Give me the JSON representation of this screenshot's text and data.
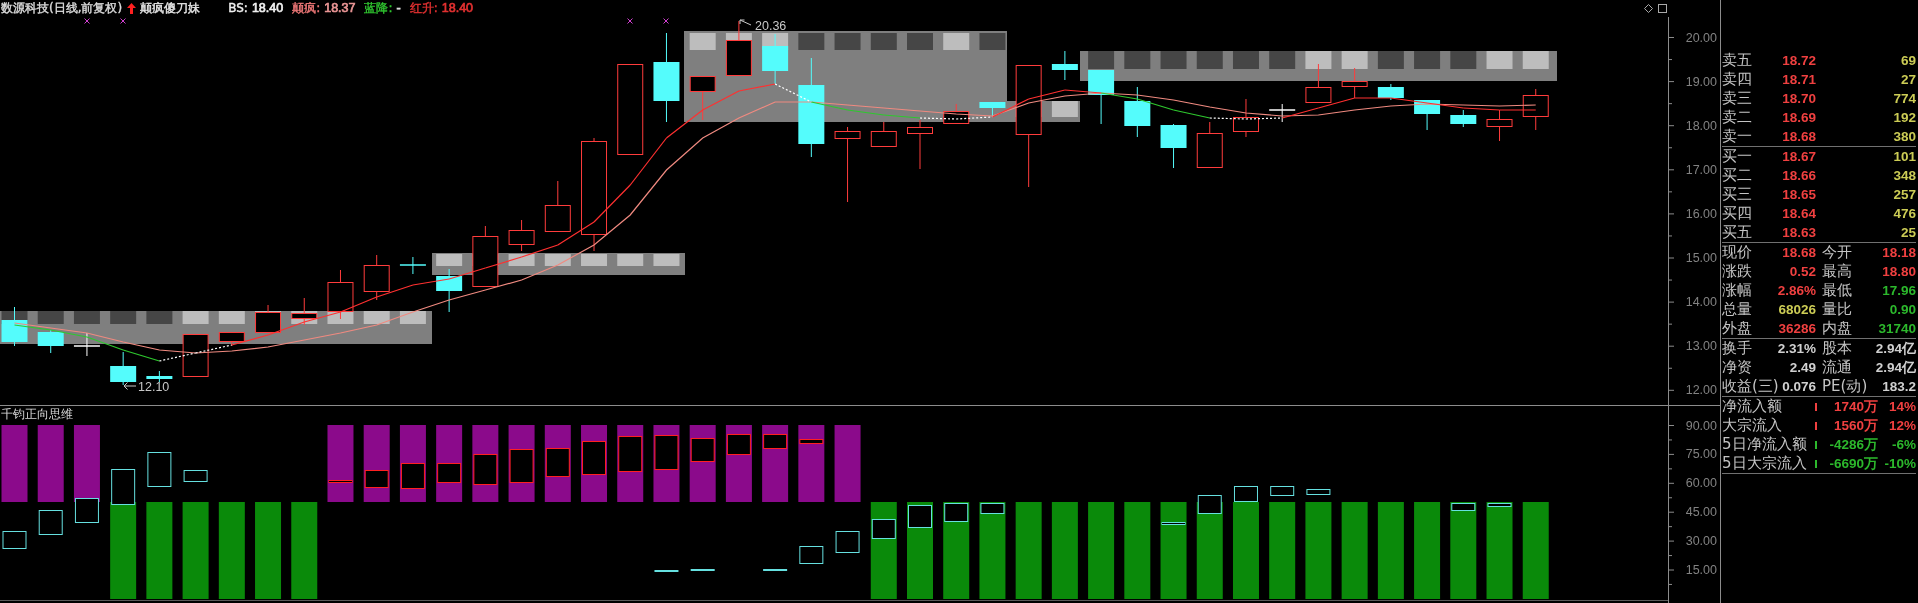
{
  "header": {
    "security": "数源科技(日线,前复权)",
    "formula": "颠疯傻刀妹",
    "readouts": [
      {
        "label": "BS:",
        "color": "#f0f0f0",
        "value": {
          "text": "18.40",
          "color": "#f0f0f0"
        }
      },
      {
        "label": "颠疯:",
        "color": "#f07878",
        "value": {
          "text": "18.37",
          "color": "#e89494"
        }
      },
      {
        "label": "蓝降:",
        "color": "#30c830",
        "value": {
          "text": "-",
          "color": "#e0e0e0"
        }
      },
      {
        "label": "红升:",
        "color": "#e03030",
        "value": {
          "text": "18.40",
          "color": "#e03030"
        }
      }
    ]
  },
  "main_chart": {
    "high_label": "20.36",
    "low_label": "12.10",
    "axis_labels": [
      "20.00",
      "19.00",
      "18.00",
      "17.00",
      "16.00",
      "15.00",
      "14.00",
      "13.00",
      "12.00"
    ]
  },
  "indicator": {
    "title": "千钧正向思维",
    "axis_labels": [
      "90.00",
      "75.00",
      "60.00",
      "45.00",
      "30.00",
      "15.00"
    ]
  },
  "order_book": {
    "asks": [
      {
        "label": "卖五",
        "price": "18.72",
        "volume": "69"
      },
      {
        "label": "卖四",
        "price": "18.71",
        "volume": "27"
      },
      {
        "label": "卖三",
        "price": "18.70",
        "volume": "774"
      },
      {
        "label": "卖二",
        "price": "18.69",
        "volume": "192"
      },
      {
        "label": "卖一",
        "price": "18.68",
        "volume": "380"
      }
    ],
    "bids": [
      {
        "label": "买一",
        "price": "18.67",
        "volume": "101"
      },
      {
        "label": "买二",
        "price": "18.66",
        "volume": "348"
      },
      {
        "label": "买三",
        "price": "18.65",
        "volume": "257"
      },
      {
        "label": "买四",
        "price": "18.64",
        "volume": "476"
      },
      {
        "label": "买五",
        "price": "18.63",
        "volume": "25"
      }
    ]
  },
  "stat_groups": [
    {
      "rows": [
        {
          "cells": [
            {
              "label": "现价",
              "value": "18.68",
              "color": "#f04040"
            },
            {
              "label": "今开",
              "value": "18.18",
              "color": "#f04040"
            }
          ]
        },
        {
          "cells": [
            {
              "label": "涨跌",
              "value": "0.52",
              "color": "#f04040"
            },
            {
              "label": "最高",
              "value": "18.80",
              "color": "#f04040"
            }
          ]
        },
        {
          "cells": [
            {
              "label": "涨幅",
              "value": "2.86%",
              "color": "#f04040"
            },
            {
              "label": "最低",
              "value": "17.96",
              "color": "#2cb82c"
            }
          ]
        },
        {
          "cells": [
            {
              "label": "总量",
              "value": "68026",
              "color": "#cccc55"
            },
            {
              "label": "量比",
              "value": "0.90",
              "color": "#2cb82c"
            }
          ]
        },
        {
          "cells": [
            {
              "label": "外盘",
              "value": "36286",
              "color": "#f04040"
            },
            {
              "label": "内盘",
              "value": "31740",
              "color": "#2cb82c"
            }
          ]
        }
      ]
    },
    {
      "rows": [
        {
          "cells": [
            {
              "label": "换手",
              "value": "2.31%",
              "color": "#d0d0d0"
            },
            {
              "label": "股本",
              "value": "2.94亿",
              "color": "#d0d0d0"
            }
          ]
        },
        {
          "cells": [
            {
              "label": "净资",
              "value": "2.49",
              "color": "#d0d0d0"
            },
            {
              "label": "流通",
              "value": "2.94亿",
              "color": "#d0d0d0"
            }
          ]
        },
        {
          "cells": [
            {
              "label": "收益(三)",
              "value": "0.076",
              "color": "#d0d0d0"
            },
            {
              "label": "PE(动)",
              "value": "183.2",
              "color": "#d0d0d0"
            }
          ]
        }
      ]
    }
  ],
  "fund_flow": [
    {
      "label": "净流入额",
      "amount": "1740万",
      "percent": "14%",
      "color": "#f04040"
    },
    {
      "label": "大宗流入",
      "amount": "1560万",
      "percent": "12%",
      "color": "#f04040"
    },
    {
      "label": "5日净流入额",
      "amount": "-4286万",
      "percent": "-6%",
      "color": "#2cb82c"
    },
    {
      "label": "5日大宗流入",
      "amount": "-6690万",
      "percent": "-10%",
      "color": "#2cb82c"
    }
  ]
}
